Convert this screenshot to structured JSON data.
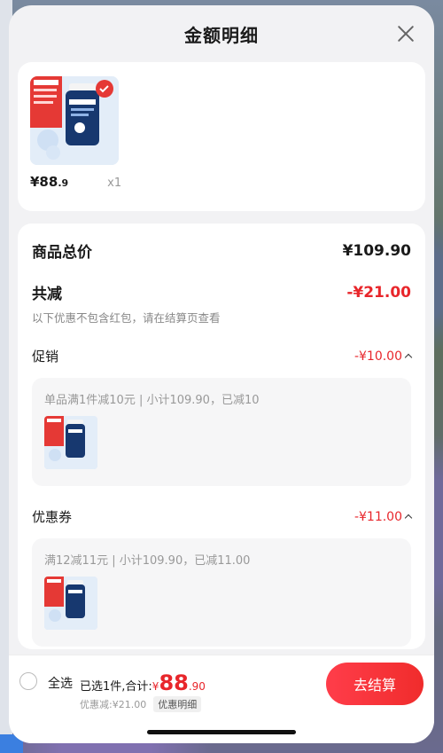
{
  "header": {
    "title": "金额明细"
  },
  "product": {
    "price_int": "¥88",
    "price_dec": ".9",
    "qty": "x1"
  },
  "summary": {
    "total_label": "商品总价",
    "total_value": "¥109.90",
    "discount_label": "共减",
    "discount_value": "-¥21.00",
    "note": "以下优惠不包含红包，请在结算页查看"
  },
  "sections": [
    {
      "label": "促销",
      "amount": "-¥10.00",
      "detail": "单品满1件减10元 | 小计109.90，已减10"
    },
    {
      "label": "优惠券",
      "amount": "-¥11.00",
      "detail": "满12减11元 | 小计109.90，已减11.00"
    }
  ],
  "footer": {
    "select_all": "全选",
    "selected_prefix": "已选1件,合计:",
    "yen": "¥",
    "total_int": "88",
    "total_dec": ".90",
    "saved": "优惠减:¥21.00",
    "detail_badge": "优惠明细",
    "checkout": "去结算"
  },
  "colors": {
    "accent": "#e8262b",
    "button": "#f02c2c"
  }
}
